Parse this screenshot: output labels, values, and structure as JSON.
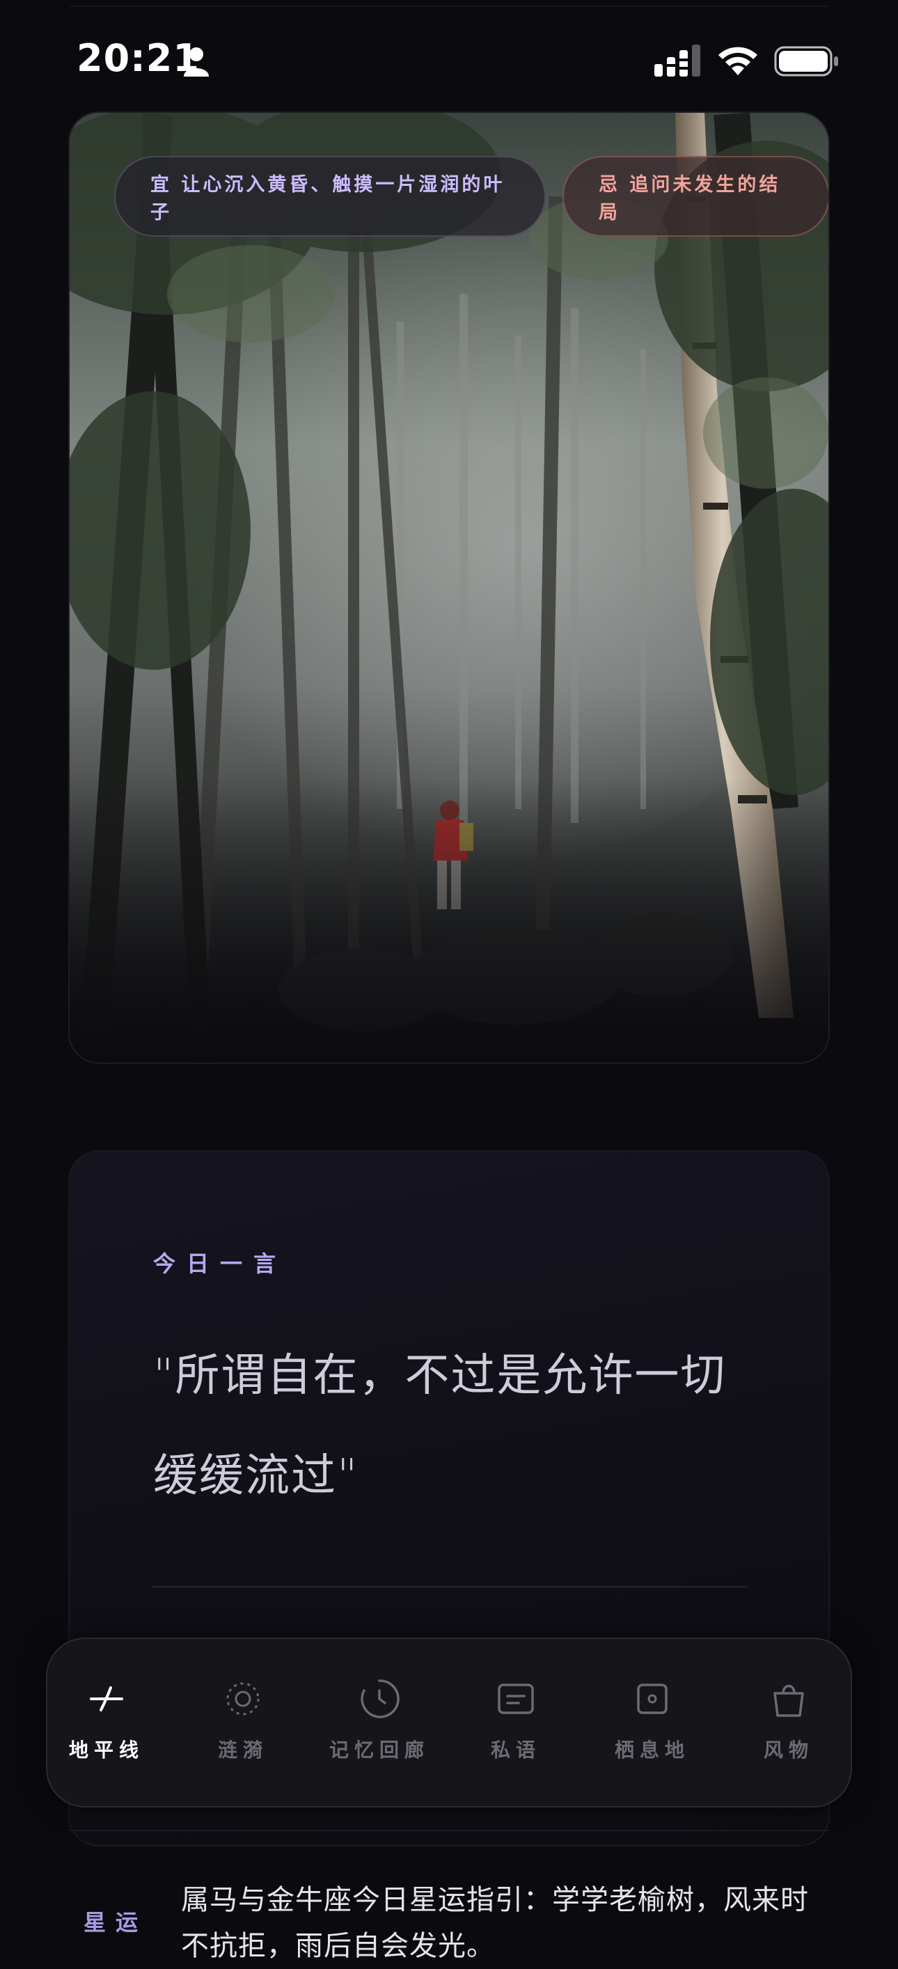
{
  "status_bar": {
    "time": "20:21",
    "icons": [
      "person-icon",
      "cellular-signal-icon",
      "wifi-icon",
      "battery-icon"
    ]
  },
  "hero": {
    "image": "misty forest with hiker in red jacket",
    "yi_text": "宜 让心沉入黄昏、触摸一片湿润的叶子",
    "ji_text": "忌 追问未发生的结局",
    "colors": {
      "yi_accent": "#cbbcff",
      "ji_accent": "#f2a49c"
    }
  },
  "quote_card": {
    "label": "今日一言",
    "quote": "\"所谓自在，不过是允许一切缓缓流过\"",
    "author": "",
    "colors": {
      "label": "#b8a8f0"
    }
  },
  "tab_bar": {
    "tabs": [
      {
        "label": "地平线",
        "icon": "horizon-icon",
        "active": true
      },
      {
        "label": "涟漪",
        "icon": "ripple-icon",
        "active": false
      },
      {
        "label": "记忆回廊",
        "icon": "clock-icon",
        "active": false
      },
      {
        "label": "私语",
        "icon": "message-icon",
        "active": false
      },
      {
        "label": "栖息地",
        "icon": "habitat-icon",
        "active": false
      },
      {
        "label": "风物",
        "icon": "bag-icon",
        "active": false
      }
    ]
  },
  "horoscope": {
    "label": "星运",
    "text": "属马与金牛座今日星运指引：学学老榆树，风来时不抗拒，雨后自会发光。"
  }
}
